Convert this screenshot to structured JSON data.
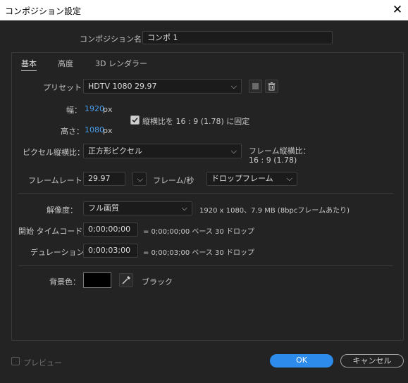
{
  "window": {
    "title": "コンポジション設定"
  },
  "comp_name": {
    "label": "コンポジション名：",
    "value": "コンポ 1"
  },
  "tabs": [
    {
      "label": "基本"
    },
    {
      "label": "高度"
    },
    {
      "label": "3D レンダラー"
    }
  ],
  "preset": {
    "label": "プリセット：",
    "value": "HDTV 1080 29.97"
  },
  "width": {
    "label": "幅：",
    "value": "1920",
    "unit": "px"
  },
  "height": {
    "label": "高さ：",
    "value": "1080",
    "unit": "px"
  },
  "aspect_lock": {
    "label": "縦横比を 16 : 9 (1.78) に固定",
    "checked": true
  },
  "pixel_aspect": {
    "label": "ピクセル縦横比：",
    "value": "正方形ピクセル",
    "frame_aspect_label": "フレーム縦横比：",
    "frame_aspect_value": "16 : 9 (1.78)"
  },
  "frame_rate": {
    "label": "フレームレート：",
    "value": "29.97",
    "unit": "フレーム/秒",
    "drop": "ドロップフレーム"
  },
  "resolution": {
    "label": "解像度：",
    "value": "フル画質",
    "info": "1920 x 1080、7.9 MB (8bpcフレームあたり)"
  },
  "start_tc": {
    "label": "開始 タイムコード：",
    "value": "0;00;00;00",
    "info": "= 0;00;00;00 ベース 30 ドロップ"
  },
  "duration": {
    "label": "デュレーション：",
    "value": "0;00;03;00",
    "info": "= 0;00;03;00 ベース 30 ドロップ"
  },
  "bg_color": {
    "label": "背景色：",
    "name": "ブラック",
    "swatch": "#000000"
  },
  "footer": {
    "preview_label": "プレビュー",
    "ok": "OK",
    "cancel": "キャンセル"
  },
  "colors": {
    "accent": "#2d8ceb",
    "value_blue": "#4a9be8",
    "background": "#232323"
  }
}
